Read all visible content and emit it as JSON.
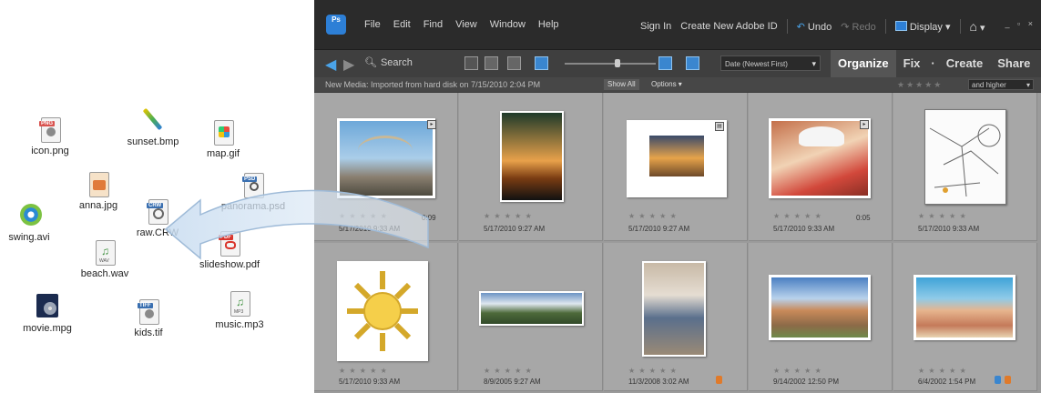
{
  "desktop": {
    "files": [
      {
        "name": "icon.png",
        "tag": "PNG"
      },
      {
        "name": "sunset.bmp",
        "tag": ""
      },
      {
        "name": "map.gif",
        "tag": ""
      },
      {
        "name": "anna.jpg",
        "tag": ""
      },
      {
        "name": "panorama.psd",
        "tag": "PSD"
      },
      {
        "name": "swing.avi",
        "tag": ""
      },
      {
        "name": "raw.CRW",
        "tag": "CRW"
      },
      {
        "name": "slideshow.pdf",
        "tag": "PDF"
      },
      {
        "name": "beach.wav",
        "tag": "WAV"
      },
      {
        "name": "movie.mpg",
        "tag": ""
      },
      {
        "name": "kids.tif",
        "tag": "TIFF"
      },
      {
        "name": "music.mp3",
        "tag": "MP3"
      }
    ]
  },
  "app": {
    "logo_text": "Ps",
    "menu": [
      "File",
      "Edit",
      "Find",
      "View",
      "Window",
      "Help"
    ],
    "sign_in": "Sign In",
    "create_id": "Create New Adobe ID",
    "undo": "Undo",
    "redo": "Redo",
    "display": "Display",
    "search_placeholder": "Search",
    "sort_value": "Date (Newest First)",
    "modes": [
      "Organize",
      "Fix",
      "Create",
      "Share"
    ],
    "info": "New Media: Imported from hard disk on 7/15/2010 2:04 PM",
    "show_all": "Show All",
    "options": "Options",
    "rating_filter": "and higher",
    "accent": "#4aa3e8"
  },
  "grid": {
    "stars": "★ ★ ★ ★ ★",
    "items": [
      {
        "date": "5/17/2010 9:33 AM",
        "badge": "0:09",
        "kind": "carousel"
      },
      {
        "date": "5/17/2010 9:27 AM",
        "badge": "",
        "kind": "palm"
      },
      {
        "date": "5/17/2010 9:27 AM",
        "badge": "",
        "kind": "sunset"
      },
      {
        "date": "5/17/2010 9:33 AM",
        "badge": "0:05",
        "kind": "girl"
      },
      {
        "date": "5/17/2010 9:33 AM",
        "badge": "",
        "kind": "map"
      },
      {
        "date": "5/17/2010 9:33 AM",
        "badge": "",
        "kind": "sun"
      },
      {
        "date": "8/9/2005 9:27 AM",
        "badge": "",
        "kind": "panorama"
      },
      {
        "date": "11/3/2008 3:02 AM",
        "badge": "",
        "kind": "woman"
      },
      {
        "date": "9/14/2002 12:50 PM",
        "badge": "",
        "kind": "ruins"
      },
      {
        "date": "6/4/2002 1:54 PM",
        "badge": "",
        "kind": "kids"
      }
    ]
  }
}
